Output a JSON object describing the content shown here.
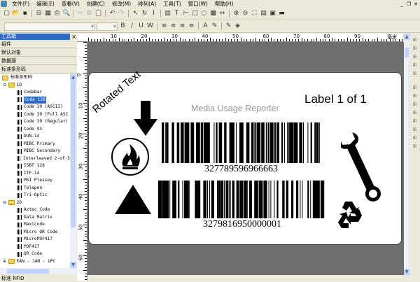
{
  "menu": [
    "文件(F)",
    "编辑(E)",
    "查看(V)",
    "创建(C)",
    "修改(M)",
    "排列(A)",
    "工具(T)",
    "窗口(W)",
    "帮助(H)"
  ],
  "window_controls": [
    "_",
    "❐",
    "✕"
  ],
  "toolbar1": [
    {
      "n": "new-icon",
      "g": "▢"
    },
    {
      "n": "open-icon",
      "g": "📂"
    },
    {
      "n": "save-icon",
      "g": "▪"
    },
    {
      "n": "sep"
    },
    {
      "n": "page-setup-icon",
      "g": "⊟"
    },
    {
      "n": "grid-icon",
      "g": "▦"
    },
    {
      "n": "print-icon",
      "g": "⎙"
    },
    {
      "n": "print-preview-icon",
      "g": "🔍"
    },
    {
      "n": "sep"
    },
    {
      "n": "cut-icon",
      "g": "✂",
      "d": 1
    },
    {
      "n": "copy-icon",
      "g": "⧉",
      "d": 1
    },
    {
      "n": "paste-icon",
      "g": "📋"
    },
    {
      "n": "sep"
    },
    {
      "n": "undo-icon",
      "g": "↶"
    },
    {
      "n": "redo-icon",
      "g": "↷",
      "d": 1
    },
    {
      "n": "sep"
    },
    {
      "n": "select-pointer-icon",
      "g": "↖"
    },
    {
      "n": "rotate-icon",
      "g": "↻"
    },
    {
      "n": "text-cursor-icon",
      "g": "I"
    },
    {
      "n": "sep"
    },
    {
      "n": "barcode-tool-icon",
      "g": "▥"
    },
    {
      "n": "text-tool-icon",
      "g": "T"
    },
    {
      "n": "line-tool-icon",
      "g": "⊢"
    },
    {
      "n": "rectangle-tool-icon",
      "g": "□"
    },
    {
      "n": "ellipse-tool-icon",
      "g": "○"
    },
    {
      "n": "image-tool-icon",
      "g": "▩"
    },
    {
      "n": "dimension-tool-icon",
      "g": "↔"
    },
    {
      "n": "sep"
    },
    {
      "n": "zoom-in-icon",
      "g": "⊕"
    },
    {
      "n": "zoom-out-icon",
      "g": "⊖"
    },
    {
      "n": "zoom-fit-icon",
      "g": "⛶"
    },
    {
      "n": "view-page-icon",
      "g": "▤"
    },
    {
      "n": "view-label-icon",
      "g": "▣"
    },
    {
      "n": "view-printer-icon",
      "g": "▬"
    }
  ],
  "toolbar2": [
    {
      "n": "bold-icon",
      "g": "B"
    },
    {
      "n": "italic-icon",
      "g": "/"
    },
    {
      "n": "underline-icon",
      "g": "U"
    },
    {
      "n": "wordwrap-icon",
      "g": "W"
    },
    {
      "n": "sep"
    },
    {
      "n": "align-left-icon",
      "g": "≡"
    },
    {
      "n": "align-center-icon",
      "g": "≡"
    },
    {
      "n": "align-right-icon",
      "g": "≡"
    },
    {
      "n": "justify-icon",
      "g": "≡"
    },
    {
      "n": "sep"
    },
    {
      "n": "text-color-icon",
      "g": "A"
    },
    {
      "n": "line-color-icon",
      "g": "✎"
    },
    {
      "n": "sep"
    },
    {
      "n": "pen-icon",
      "g": "✎"
    },
    {
      "n": "fill-color-icon",
      "g": "◈"
    }
  ],
  "toolbox": {
    "title": "工具箱",
    "close": "×",
    "sections": [
      "组件",
      "默认对象",
      "数据源",
      "标准条形码"
    ],
    "tree_root": "标准条形码",
    "groups": [
      {
        "label": "1D",
        "items": [
          "Codabar",
          "Code 128",
          "Code 39 (ASCII)",
          "Code 39 (Full ASC",
          "Code 39 (Regular)",
          "Code 93",
          "DUN-14",
          "MIBC Primary",
          "MIBC Secondary",
          "Interleaved 2-of-5",
          "ISBT 128",
          "ITF-14",
          "MSI Plessey",
          "Telepen",
          "Tri-Optic"
        ]
      },
      {
        "label": "2D",
        "items": [
          "Aztec Code",
          "Data Matrix",
          "Maxicode",
          "Micro QR Code",
          "MicroPDF417",
          "PDF417",
          "QR Code"
        ]
      },
      {
        "label": "EAN - JAN - UPC",
        "items": []
      }
    ],
    "selected": "Code 128",
    "footer": "标准 RFID"
  },
  "ruler": {
    "unit": "毫米",
    "h_ticks": [
      "10",
      "20",
      "30",
      "40",
      "50",
      "60",
      "70",
      "80",
      "90"
    ],
    "v_ticks": [
      "0",
      "10",
      "20",
      "30",
      "40",
      "50",
      "60"
    ]
  },
  "label": {
    "rotated_text": "Rotated Text",
    "title": "Media Usage Reporter",
    "counter": "Label 1 of 1",
    "barcode1": "327789596966663",
    "barcode2": "3279816950000001"
  }
}
